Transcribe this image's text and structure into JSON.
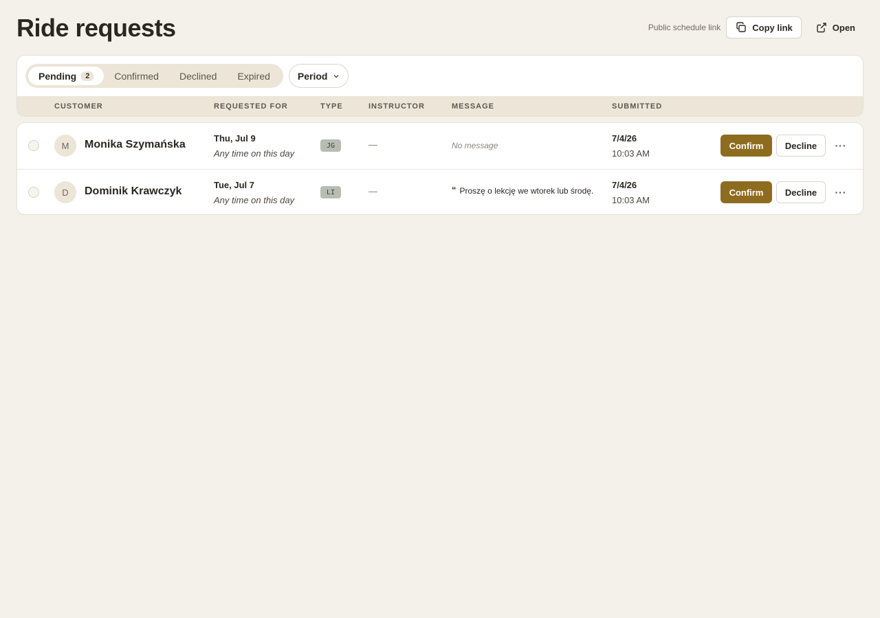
{
  "header": {
    "title": "Ride requests",
    "public_link_label": "Public schedule link",
    "copy_link_label": "Copy link",
    "open_label": "Open"
  },
  "filters": {
    "tabs": [
      {
        "label": "Pending",
        "count": "2",
        "active": true
      },
      {
        "label": "Confirmed"
      },
      {
        "label": "Declined"
      },
      {
        "label": "Expired"
      }
    ],
    "period_label": "Period"
  },
  "table": {
    "columns": [
      "CUSTOMER",
      "REQUESTED FOR",
      "TYPE",
      "INSTRUCTOR",
      "MESSAGE",
      "SUBMITTED"
    ],
    "rows": [
      {
        "initial": "M",
        "customer": "Monika Szymańska",
        "date": "Thu, Jul 9",
        "time": "Any time on this day",
        "type": "JG",
        "instructor": "—",
        "message": "No message",
        "submitted_date": "7/4/26",
        "submitted_time": "10:03 AM",
        "confirm": "Confirm",
        "decline": "Decline",
        "more": "···"
      },
      {
        "initial": "D",
        "customer": "Dominik Krawczyk",
        "date": "Tue, Jul 7",
        "time": "Any time on this day",
        "type": "LI",
        "instructor": "—",
        "message": "Proszę o lekcję we wtorek lub środę.",
        "submitted_date": "7/4/26",
        "submitted_time": "10:03 AM",
        "confirm": "Confirm",
        "decline": "Decline",
        "more": "···"
      }
    ]
  },
  "colors": {
    "background": "#f4f1ea",
    "accent": "#8e6c1f",
    "tab_track": "#ece5d8"
  },
  "icons": {
    "copy": "copy-icon",
    "open": "external-link-icon",
    "period": "chevron-down-icon",
    "quote": "quote-icon",
    "more": "more-horizontal-icon"
  }
}
